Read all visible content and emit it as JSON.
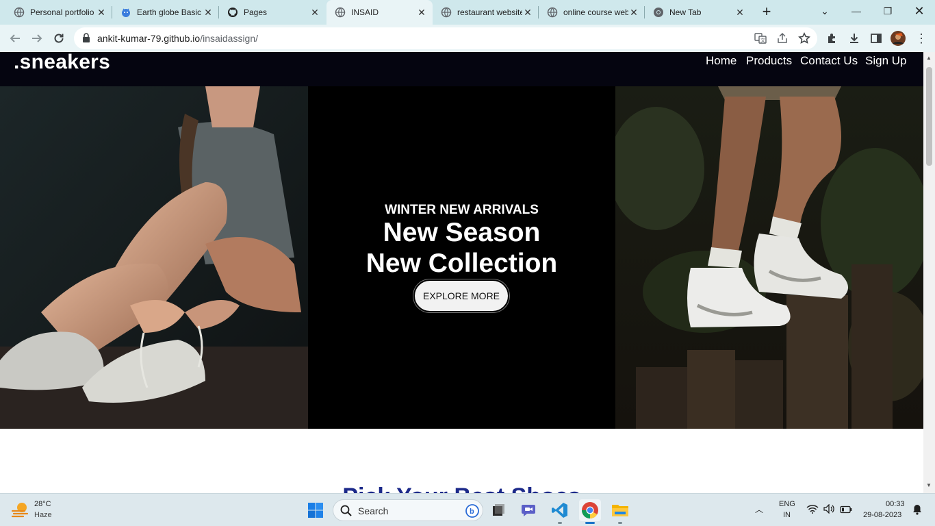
{
  "browser": {
    "tabs": [
      {
        "title": "Personal portfolio",
        "icon": "globe-icon"
      },
      {
        "title": "Earth globe Basic",
        "icon": "earth-globe-icon"
      },
      {
        "title": "Pages",
        "icon": "github-icon"
      },
      {
        "title": "INSAID",
        "icon": "globe-icon",
        "active": true
      },
      {
        "title": "restaurant website",
        "icon": "globe-icon"
      },
      {
        "title": "online course web",
        "icon": "globe-icon"
      },
      {
        "title": "New Tab",
        "icon": "chrome-icon"
      }
    ],
    "new_tab": "+",
    "url_domain": "ankit-kumar-79.github.io",
    "url_path": "/insaidassign/"
  },
  "site": {
    "brand": ".sneakers",
    "nav": [
      "Home",
      "Products",
      "Contact Us",
      "Sign Up"
    ],
    "hero": {
      "subtitle": "WINTER NEW ARRIVALS",
      "title_line1": "New Season",
      "title_line2": "New Collection",
      "button": "EXPLORE MORE"
    },
    "section_heading": "Pick Your Best Shoes"
  },
  "taskbar": {
    "weather_temp": "28°C",
    "weather_desc": "Haze",
    "search_placeholder": "Search",
    "lang_top": "ENG",
    "lang_bottom": "IN",
    "time": "00:33",
    "date": "29-08-2023"
  },
  "colors": {
    "tabstrip": "#cfe8ec",
    "toolbar": "#e9f4f6",
    "navbar": "#050510",
    "heading": "#1c2a8a"
  }
}
